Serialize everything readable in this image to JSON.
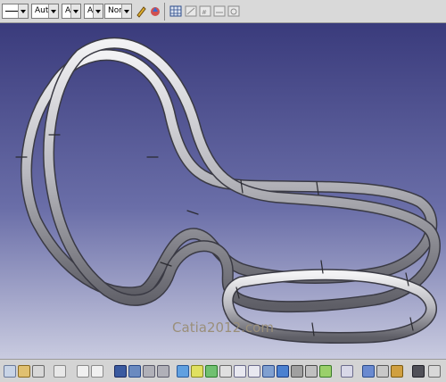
{
  "toolbar": {
    "line_type_value": "",
    "thickness_value": "Auto",
    "line_value_a": "Aut",
    "line_value_b": "Aut",
    "layer_value": "None"
  },
  "watermark": {
    "text": "Catia2012.com"
  },
  "colors": {
    "toolbar_bg": "#d9d9d9",
    "viewport_top": "#3a3b7c",
    "viewport_bottom": "#c9cbe0",
    "tube": "#c8c8cc"
  }
}
